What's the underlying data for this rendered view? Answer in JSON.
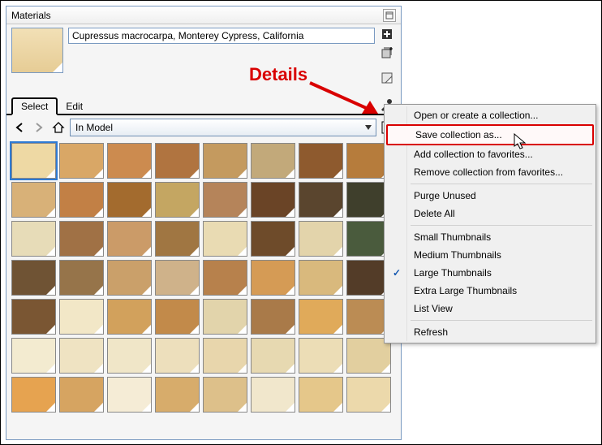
{
  "panel": {
    "title": "Materials",
    "material_name": "Cupressus macrocarpa, Monterey Cypress, California",
    "preview_color": "#ecd9aa",
    "tabs": {
      "select": "Select",
      "edit": "Edit"
    },
    "nav": {
      "collection_label": "In Model"
    }
  },
  "side_tools": [
    "create-material",
    "duplicate-material",
    "set-default"
  ],
  "annotation": {
    "label": "Details"
  },
  "thumbnails": [
    "#eed9a4",
    "#d9a766",
    "#cc8b4f",
    "#b07440",
    "#c49a5f",
    "#c2a97a",
    "#8e5a2e",
    "#b67c3c",
    "#d8b178",
    "#c28045",
    "#a36b2e",
    "#c4a662",
    "#b5845a",
    "#6a4426",
    "#5a452e",
    "#3f3f2c",
    "#e7dcb8",
    "#a07145",
    "#cb9b68",
    "#a07642",
    "#e9dbb3",
    "#6e4b2a",
    "#e3d4ab",
    "#4a5b3d",
    "#6f5334",
    "#96744a",
    "#caa06a",
    "#cfb28a",
    "#b7814c",
    "#d59b55",
    "#d9b97d",
    "#533c28",
    "#7a5633",
    "#f2e7c7",
    "#d2a15c",
    "#c28a4a",
    "#e2d4ab",
    "#a97a49",
    "#e0aa5a",
    "#bb8c54",
    "#f3ebd0",
    "#efe3c2",
    "#f0e6c8",
    "#eddfbc",
    "#e8d6ac",
    "#e7d9b1",
    "#ecddb6",
    "#e2cf9f",
    "#e6a350",
    "#d6a461",
    "#f5ecd6",
    "#d7ac6b",
    "#ddc08a",
    "#f1e7cc",
    "#e5c78a",
    "#ecd9ab"
  ],
  "selected_thumb_index": 0,
  "context_menu": {
    "items": [
      {
        "label": "Open or create a collection..."
      },
      {
        "label": "Save collection as...",
        "highlight": true
      },
      {
        "label": "Add collection to favorites..."
      },
      {
        "label": "Remove collection from favorites..."
      },
      {
        "sep": true
      },
      {
        "label": "Purge Unused"
      },
      {
        "label": "Delete All"
      },
      {
        "sep": true
      },
      {
        "label": "Small Thumbnails"
      },
      {
        "label": "Medium Thumbnails"
      },
      {
        "label": "Large Thumbnails",
        "checked": true
      },
      {
        "label": "Extra Large Thumbnails"
      },
      {
        "label": "List View"
      },
      {
        "sep": true
      },
      {
        "label": "Refresh"
      }
    ]
  }
}
